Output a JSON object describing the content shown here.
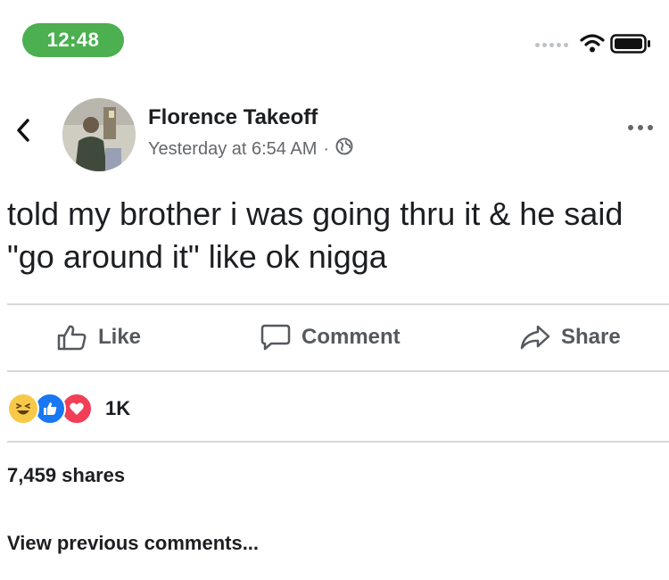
{
  "status_bar": {
    "time": "12:48",
    "colors": {
      "time_pill": "#4caf50"
    },
    "icons": [
      "signal-dots-icon",
      "wifi-icon",
      "battery-icon"
    ]
  },
  "header": {
    "back_icon": "chevron-left-icon",
    "author_name": "Florence Takeoff",
    "timestamp": "Yesterday at 6:54 AM",
    "separator": "·",
    "privacy_icon": "globe-icon",
    "more_icon": "more-dots-icon"
  },
  "post": {
    "text": "told my brother i was going thru it & he said \"go around it\" like ok nigga"
  },
  "actions": [
    {
      "label": "Like",
      "icon": "thumbs-up-icon"
    },
    {
      "label": "Comment",
      "icon": "comment-icon"
    },
    {
      "label": "Share",
      "icon": "share-icon"
    }
  ],
  "reactions": {
    "icons": [
      "haha-reaction-icon",
      "like-reaction-icon",
      "love-reaction-icon"
    ],
    "count": "1K"
  },
  "shares": "7,459 shares",
  "comments": {
    "view_previous": "View previous comments..."
  }
}
